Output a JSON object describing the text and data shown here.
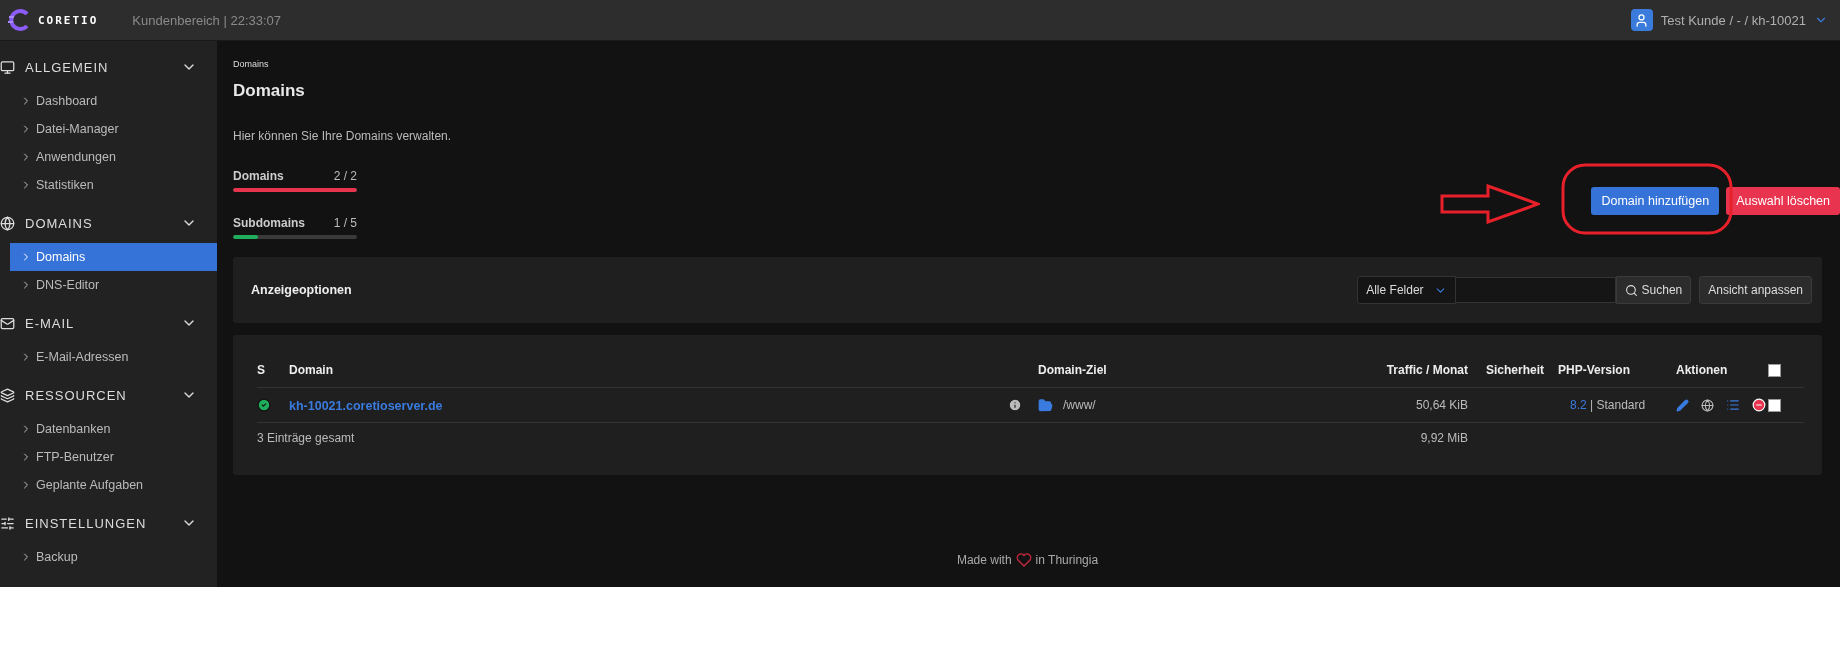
{
  "topbar": {
    "brand": "CORETIO",
    "subtitle": "Kundenbereich | 22:33:07",
    "user": "Test Kunde / - / kh-10021"
  },
  "sidebar": {
    "sections": [
      {
        "title": "ALLGEMEIN",
        "expanded": true,
        "items": [
          {
            "label": "Dashboard",
            "selected": false
          },
          {
            "label": "Datei-Manager",
            "selected": false
          },
          {
            "label": "Anwendungen",
            "selected": false
          },
          {
            "label": "Statistiken",
            "selected": false
          }
        ]
      },
      {
        "title": "DOMAINS",
        "expanded": true,
        "items": [
          {
            "label": "Domains",
            "selected": true
          },
          {
            "label": "DNS-Editor",
            "selected": false
          }
        ]
      },
      {
        "title": "E-MAIL",
        "expanded": true,
        "items": [
          {
            "label": "E-Mail-Adressen",
            "selected": false
          }
        ]
      },
      {
        "title": "RESSOURCEN",
        "expanded": true,
        "items": [
          {
            "label": "Datenbanken",
            "selected": false
          },
          {
            "label": "FTP-Benutzer",
            "selected": false
          },
          {
            "label": "Geplante Aufgaben",
            "selected": false
          }
        ]
      },
      {
        "title": "EINSTELLUNGEN",
        "expanded": true,
        "items": [
          {
            "label": "Backup",
            "selected": false
          }
        ]
      }
    ]
  },
  "breadcrumb": "Domains",
  "title": "Domains",
  "description": "Hier können Sie Ihre Domains verwalten.",
  "quotas": [
    {
      "label": "Domains",
      "reading": "2 / 2",
      "level": 1,
      "color": "#e8344e"
    },
    {
      "label": "Subdomains",
      "reading": "1 / 5",
      "level": 0.2,
      "color": "#1fae5b"
    }
  ],
  "actions": [
    {
      "label": "Domain hinzufügen",
      "kind": "primary"
    },
    {
      "label": "Auswahl löschen",
      "kind": "danger"
    }
  ],
  "options": {
    "title": "Anzeigeoptionen",
    "field_select": "Alle Felder",
    "search_button": "Suchen",
    "view_button": "Ansicht anpassen"
  },
  "table": {
    "columns": [
      "S",
      "Domain",
      "",
      "Domain-Ziel",
      "Traffic / Monat",
      "Sicherheit",
      "PHP-Version",
      "Aktionen"
    ],
    "select_all": {
      "checked": false
    },
    "rows": [
      {
        "active": true,
        "domain": "kh-10021.coretioserver.de",
        "target": "/www/",
        "traffic": "50,64 KiB",
        "php": "8.2",
        "php_mode": "| Standard",
        "checked": false
      }
    ],
    "footer": {
      "total": "3 Einträge gesamt",
      "traffic": "9,92 MiB"
    }
  },
  "footer": {
    "before": "Made with",
    "after": "in Thuringia"
  }
}
